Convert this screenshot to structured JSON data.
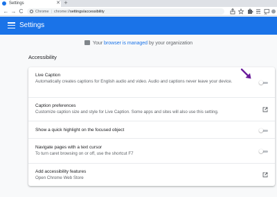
{
  "browser": {
    "tab_title": "Settings",
    "tab_close": "✕",
    "new_tab": "+",
    "nav_back": "←",
    "nav_forward": "→",
    "nav_reload": "C",
    "url_scheme": "Chrome",
    "url_separator": "|",
    "url_host": "chrome://",
    "url_path": "settings/accessibility"
  },
  "header": {
    "title": "Settings"
  },
  "managed": {
    "prefix": "Your",
    "link": "browser is managed",
    "suffix": "by your organization"
  },
  "section": {
    "title": "Accessibility"
  },
  "rows": [
    {
      "label": "Live Caption",
      "sub": "Automatically creates captions for English audio and video. Audio and captions never leave your device.",
      "control": "toggle",
      "state": "off"
    },
    {
      "label": "Caption preferences",
      "sub": "Customize caption size and style for Live Caption. Some apps and sites will also use this setting.",
      "control": "external-link"
    },
    {
      "label": "Show a quick highlight on the focused object",
      "control": "toggle",
      "state": "off"
    },
    {
      "label": "Navigate pages with a text cursor",
      "sub": "To turn caret browsing on or off, use the shortcut F7",
      "control": "toggle",
      "state": "off"
    },
    {
      "label": "Add accessibility features",
      "sub": "Open Chrome Web Store",
      "control": "external-link"
    }
  ],
  "colors": {
    "accent": "#1a73e8",
    "annotation_arrow": "#6a1b9a"
  }
}
